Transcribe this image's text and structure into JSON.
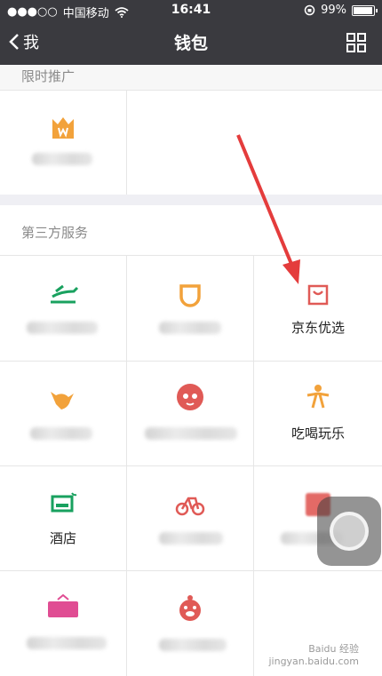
{
  "status": {
    "carrier": "中国移动",
    "time": "16:41",
    "battery": "99%",
    "battery_fraction": 0.99
  },
  "nav": {
    "back_label": "我",
    "title": "钱包"
  },
  "sections": {
    "limited": {
      "header": "限时推广"
    },
    "third_party": {
      "header": "第三方服务"
    }
  },
  "services": {
    "jd": {
      "label": "京东优选"
    },
    "food": {
      "label": "吃喝玩乐"
    },
    "hotel": {
      "label": "酒店"
    }
  },
  "icons": {
    "crown": "crown-icon",
    "train": "train-icon",
    "didi": "didi-icon",
    "shop": "shop-bag-icon",
    "kangaroo": "kangaroo-icon",
    "cat": "cat-icon",
    "person": "person-icon",
    "bed": "bed-icon",
    "bike": "bike-icon",
    "sale": "sale-tag-icon",
    "pig": "pig-icon"
  },
  "colors": {
    "nav_bg": "#3a3a3f",
    "green": "#19a15f",
    "orange": "#f2a23b",
    "red": "#e05a56",
    "pink": "#e04d93",
    "arrow": "#e43c3c"
  },
  "watermark": {
    "line1": "Baidu 经验",
    "line2": "jingyan.baidu.com"
  }
}
